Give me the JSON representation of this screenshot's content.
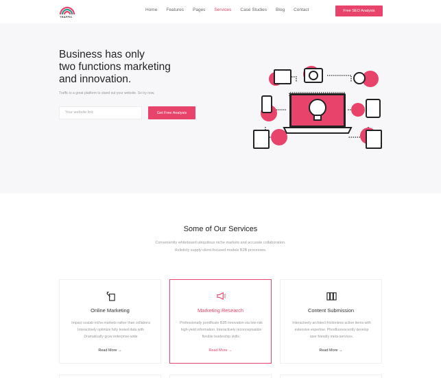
{
  "nav": {
    "logo_text": "TRAFFIC",
    "items": [
      "Home",
      "Features",
      "Pages",
      "Services",
      "Case Studies",
      "Blog",
      "Contact"
    ],
    "active": "Services",
    "cta": "Free SEO Analysis"
  },
  "hero": {
    "title_line1": "Business has only",
    "title_line2": "two functions marketing",
    "title_line3": "and innovation.",
    "subtitle": "Traffic is a great platform to stand out your website. So try now.",
    "input_placeholder": "Your website link",
    "button": "Get Free Analysis"
  },
  "services": {
    "title": "Some of Our Services",
    "desc_line1": "Conveniently whiteboard ubiquitous niche markets and accurate collaboration.",
    "desc_line2": "Holisticly supply client-focused models B2B processes.",
    "cards": [
      {
        "title": "Online Marketing",
        "icon": "marketing-icon",
        "text_line1": "Impact scalab niche markets rather than collabora",
        "text_line2": "Interactively optimize fully tested data with",
        "text_line3": "Dramatically grow enterprise-wide",
        "link": "Read More"
      },
      {
        "title": "Marketing Research",
        "icon": "megaphone-icon",
        "text_line1": "Professionally pontificate B2B innovation via low-risk",
        "text_line2": "high-yield information. Interactively reconceptualize",
        "text_line3": "flexible leadership skills.",
        "link": "Read More"
      },
      {
        "title": "Content Submission",
        "icon": "folders-icon",
        "text_line1": "Interactively architect frictionless action items with",
        "text_line2": "extensive expertise. Phosfluorescently develop",
        "text_line3": "user friendly meta-services.",
        "link": "Read More"
      }
    ]
  },
  "colors": {
    "accent": "#e8446b",
    "hero_bg": "#f7f7f9"
  }
}
